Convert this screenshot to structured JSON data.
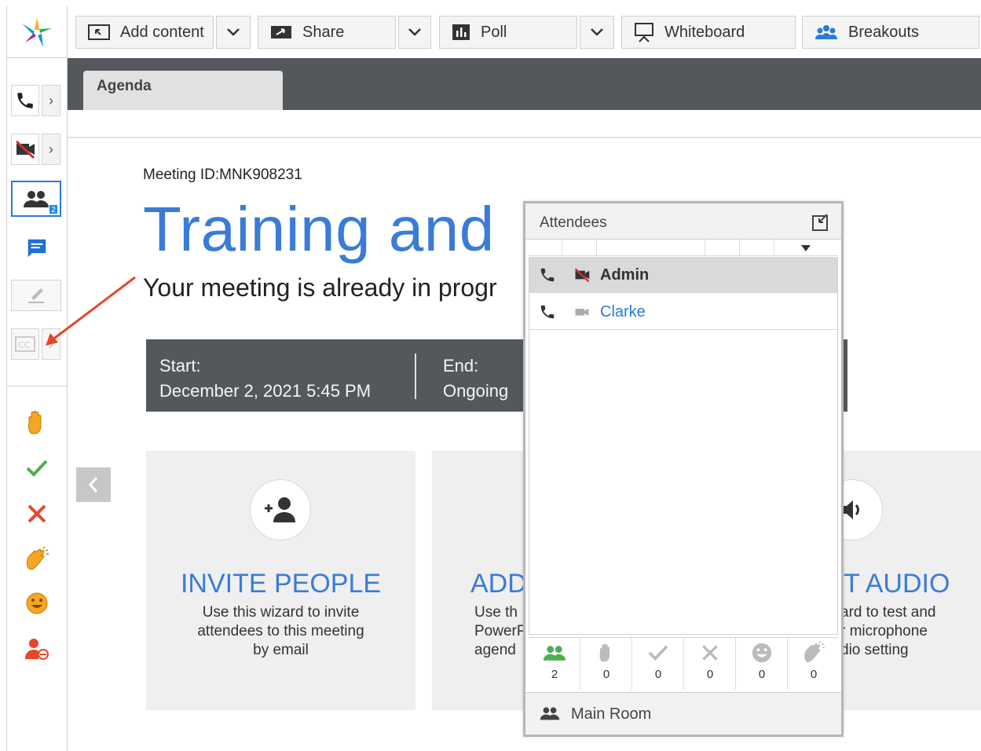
{
  "toolbar": {
    "add_content": "Add content",
    "share": "Share",
    "poll": "Poll",
    "whiteboard": "Whiteboard",
    "breakouts": "Breakouts"
  },
  "rail": {
    "attendee_badge": "2"
  },
  "tabs": [
    {
      "label": "Agenda"
    }
  ],
  "meeting": {
    "id_line": "Meeting ID:MNK908231",
    "title": "Training and",
    "subtitle": "Your meeting is already in progr",
    "start_label": "Start:",
    "start_value": "December 2, 2021 5:45 PM",
    "end_label": "End:",
    "end_value": "Ongoing"
  },
  "cards": [
    {
      "title": "INVITE PEOPLE",
      "desc": "Use this wizard to invite\nattendees to this meeting\nby email"
    },
    {
      "title": "ADD",
      "desc": "Use th\nPowerP\nagend"
    },
    {
      "title": "T AUDIO",
      "desc": "ard to test and\nr microphone\ndio setting"
    }
  ],
  "attendees_panel": {
    "title": "Attendees",
    "rows": [
      {
        "name": "Admin",
        "bold": true,
        "video": "off"
      },
      {
        "name": "Clarke",
        "bold": false,
        "video": "on"
      }
    ],
    "stats": [
      {
        "icon": "attendees-icon",
        "count": "2"
      },
      {
        "icon": "raise-hand-icon",
        "count": "0"
      },
      {
        "icon": "check-icon",
        "count": "0"
      },
      {
        "icon": "x-icon",
        "count": "0"
      },
      {
        "icon": "smile-icon",
        "count": "0"
      },
      {
        "icon": "applause-icon",
        "count": "0"
      }
    ],
    "room": "Main Room"
  },
  "colors": {
    "accent_blue": "#3b7bd8",
    "dark_bar": "#54585d",
    "green": "#4caf50",
    "red": "#e8462a",
    "orange_hand": "#f5a623"
  }
}
